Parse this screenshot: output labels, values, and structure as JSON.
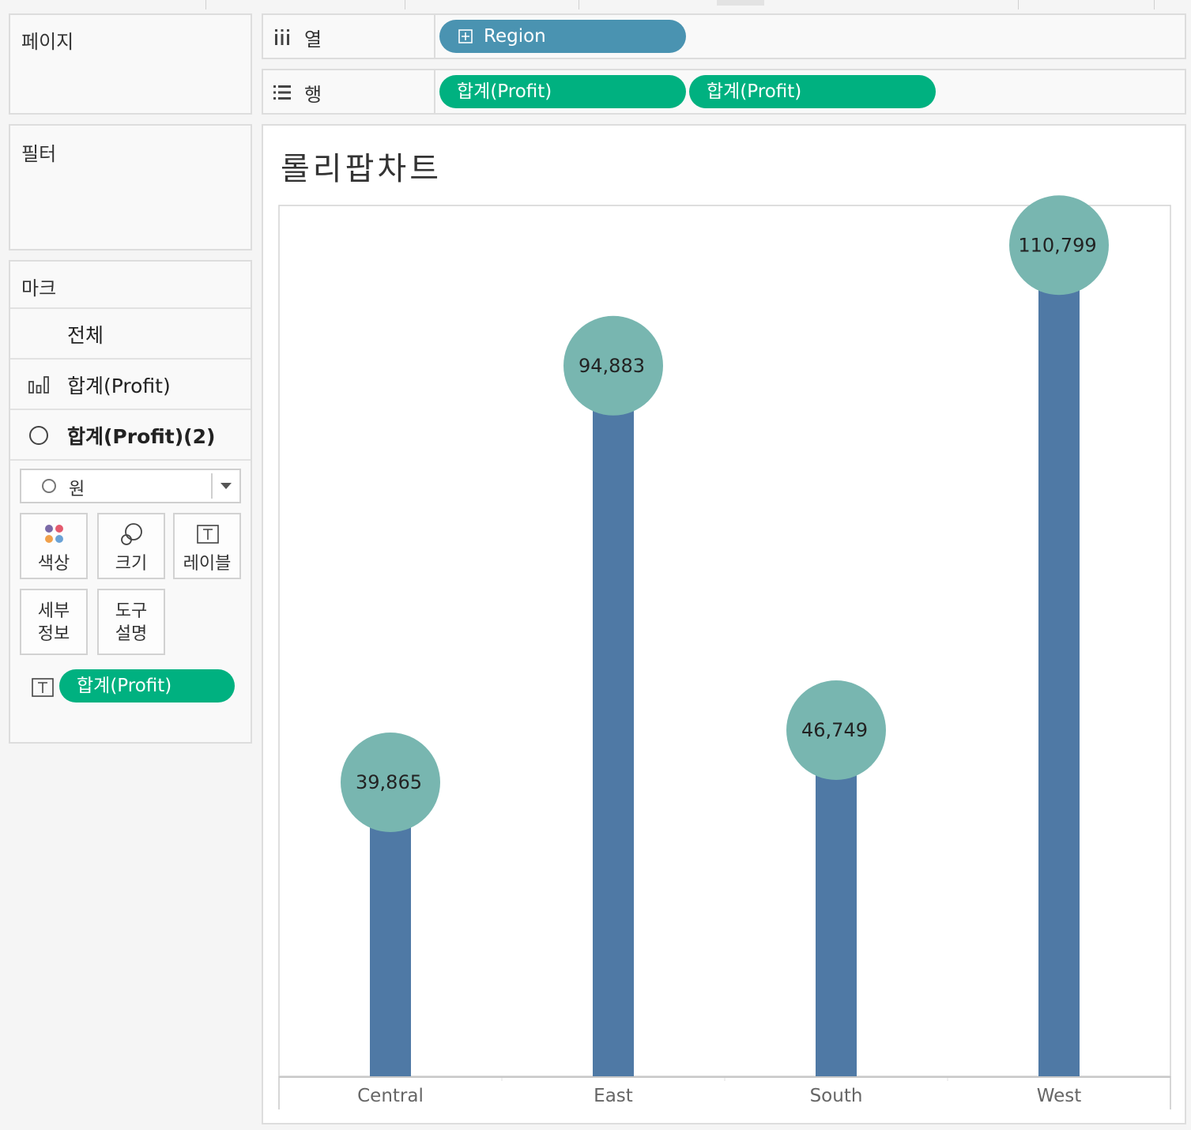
{
  "pages_panel": {
    "title": "페이지"
  },
  "filters_panel": {
    "title": "필터"
  },
  "marks_card": {
    "title": "마크",
    "rows": [
      {
        "label": "전체",
        "icon": "none"
      },
      {
        "label": "합계(Profit)",
        "icon": "bar-chart-icon"
      },
      {
        "label": "합계(Profit)(2)",
        "icon": "circle-icon"
      }
    ],
    "mark_type": {
      "selected": "원"
    },
    "buttons": {
      "color": "색상",
      "size": "크기",
      "label": "레이블",
      "detail": "세부\n정보",
      "tooltip": "도구\n설명"
    },
    "label_pill": "합계(Profit)"
  },
  "shelves": {
    "columns": {
      "label": "열",
      "pills": [
        "Region"
      ]
    },
    "rows": {
      "label": "행",
      "pills": [
        "합계(Profit)",
        "합계(Profit)"
      ]
    }
  },
  "view": {
    "title": "롤리팝차트"
  },
  "colors": {
    "bar": "#4f79a5",
    "circle": "#78b6b0",
    "pill_green": "#00b180",
    "pill_blue": "#4a93b1"
  },
  "chart_data": {
    "type": "bar",
    "style": "lollipop",
    "categories": [
      "Central",
      "East",
      "South",
      "West"
    ],
    "values": [
      39865,
      94883,
      46749,
      110799
    ],
    "labels": [
      "39,865",
      "94,883",
      "46,749",
      "110,799"
    ],
    "ylim": [
      0,
      115000
    ],
    "grid": false
  }
}
